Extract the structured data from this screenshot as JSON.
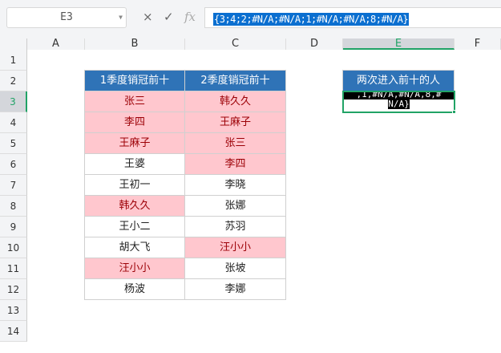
{
  "name_box": "E3",
  "formula_bar": {
    "cancel_icon": "×",
    "confirm_icon": "✓",
    "fx_label": "fx",
    "value": "{3;4;2;#N/A;#N/A;1;#N/A;#N/A;8;#N/A}"
  },
  "columns": [
    "A",
    "B",
    "C",
    "D",
    "E",
    "F"
  ],
  "rows": [
    "1",
    "2",
    "3",
    "4",
    "5",
    "6",
    "7",
    "8",
    "9",
    "10",
    "11",
    "12",
    "13",
    "14"
  ],
  "table": {
    "headers": [
      "1季度销冠前十",
      "2季度销冠前十"
    ],
    "q1": [
      "张三",
      "李四",
      "王麻子",
      "王婆",
      "王初一",
      "韩久久",
      "王小二",
      "胡大飞",
      "汪小小",
      "杨波"
    ],
    "q2": [
      "韩久久",
      "王麻子",
      "张三",
      "李四",
      "李晓",
      "张娜",
      "苏羽",
      "汪小小",
      "张坡",
      "李娜"
    ],
    "q1_highlight": [
      true,
      true,
      true,
      false,
      false,
      true,
      false,
      false,
      true,
      false
    ],
    "q2_highlight": [
      true,
      true,
      true,
      true,
      false,
      false,
      false,
      true,
      false,
      false
    ]
  },
  "result": {
    "header": "两次进入前十的人",
    "line1": ",1,#N/A,#N/A,8,#",
    "line2": "N/A}"
  },
  "colors": {
    "header": "#2f73b7",
    "highlight_fill": "#ffc7ce",
    "highlight_text": "#9c0006",
    "selection": "#21a366"
  }
}
